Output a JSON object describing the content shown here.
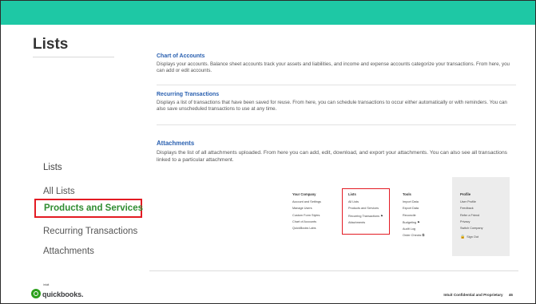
{
  "slide": {
    "title": "Lists"
  },
  "left_menu": {
    "heading": "Lists",
    "items": [
      "All Lists",
      "Products and Services",
      "Recurring Transactions",
      "Attachments"
    ],
    "active": "Products and Services"
  },
  "sections": [
    {
      "title": "Chart of Accounts",
      "description": "Displays your accounts. Balance sheet accounts track your assets and liabilities, and income and expense accounts categorize your transactions. From here, you can add or edit accounts."
    },
    {
      "title": "Recurring Transactions",
      "description": "Displays a list of transactions that have been saved for reuse. From here, you can schedule transactions to occur either automatically or with reminders. You can also save unscheduled transactions to use at any time."
    },
    {
      "title": "Attachments",
      "description": "Displays the list of all attachments uploaded. From here you can add, edit, download, and export your attachments. You can also see all transactions linked to a particular attachment."
    }
  ],
  "gear_menu": {
    "your_company": {
      "header": "Your Company",
      "items": [
        "Account and Settings",
        "Manage Users",
        "Custom Form Styles",
        "Chart of Accounts",
        "QuickBooks Labs"
      ]
    },
    "lists": {
      "header": "Lists",
      "items": [
        "All Lists",
        "Products and Services",
        "Recurring Transactions",
        "Attachments"
      ]
    },
    "tools": {
      "header": "Tools",
      "items": [
        "Import Data",
        "Export Data",
        "Reconcile",
        "Budgeting",
        "Audit Log",
        "Order Checks"
      ]
    },
    "profile": {
      "header": "Profile",
      "items": [
        "User Profile",
        "Feedback",
        "Refer a Friend",
        "Privacy",
        "Switch Company"
      ],
      "sign_out": "Sign Out"
    }
  },
  "footer": {
    "brand_small": "intuit",
    "brand": "quickbooks.",
    "confidential": "Intuit Confidential and Proprietary",
    "page_number": "46"
  },
  "colors": {
    "top_bar": "#1ec8a5",
    "highlight_border": "#e31b23",
    "active_item_text": "#2f8c31",
    "section_title": "#2a60b0"
  }
}
